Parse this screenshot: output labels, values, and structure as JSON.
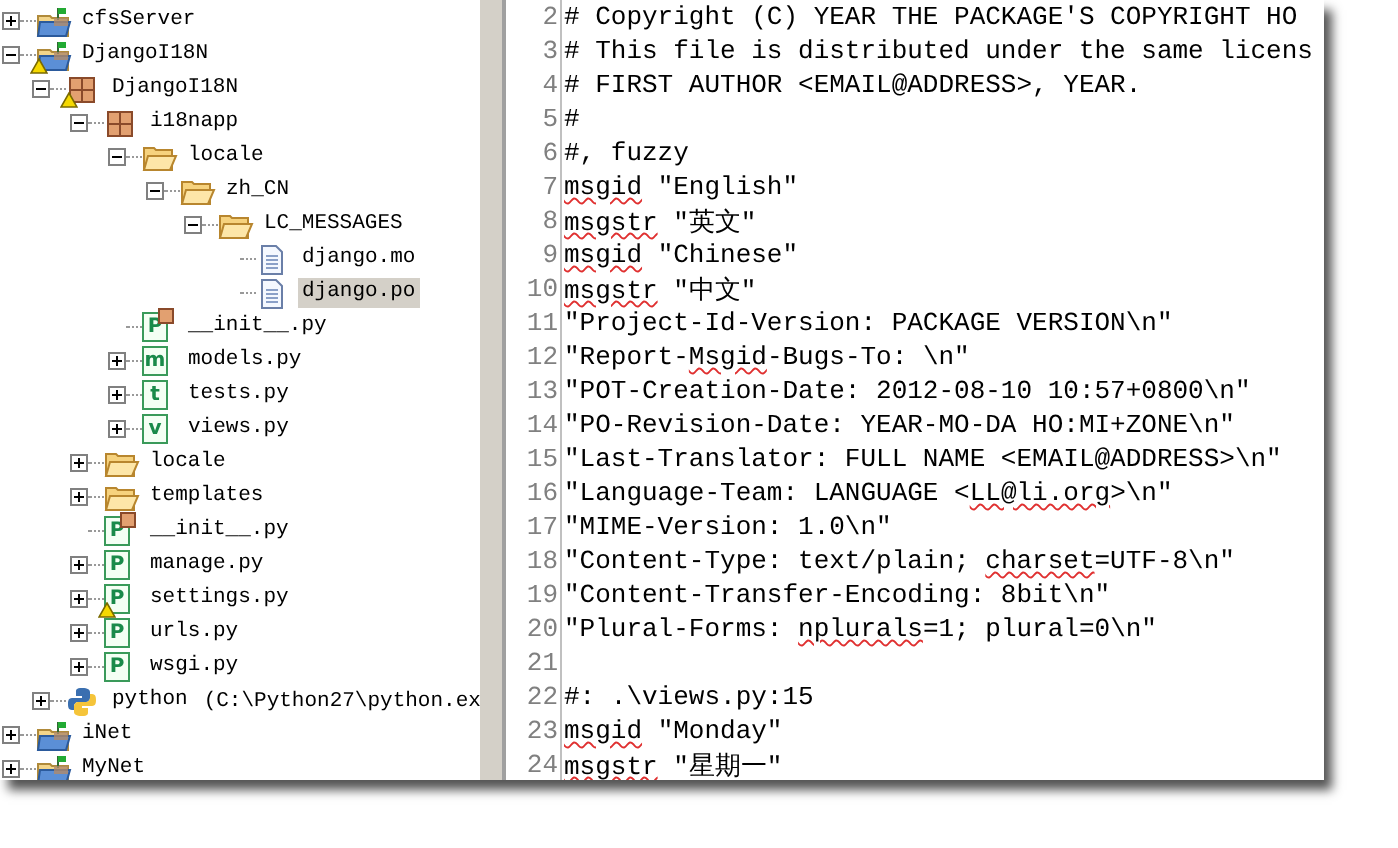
{
  "project_tree": [
    {
      "label": "cfsServer",
      "kind": "project",
      "expanded": false,
      "selected": false
    },
    {
      "label": "DjangoI18N",
      "kind": "project",
      "warning": true,
      "expanded": true,
      "selected": false,
      "children": [
        {
          "label": "DjangoI18N",
          "kind": "package",
          "warning": true,
          "expanded": true,
          "selected": false,
          "children": [
            {
              "label": "i18napp",
              "kind": "package",
              "expanded": true,
              "selected": false,
              "children": [
                {
                  "label": "locale",
                  "kind": "folder",
                  "expanded": true,
                  "selected": false,
                  "children": [
                    {
                      "label": "zh_CN",
                      "kind": "folder",
                      "expanded": true,
                      "selected": false,
                      "children": [
                        {
                          "label": "LC_MESSAGES",
                          "kind": "folder",
                          "expanded": true,
                          "selected": false,
                          "children": [
                            {
                              "label": "django.mo",
                              "kind": "file",
                              "selected": false
                            },
                            {
                              "label": "django.po",
                              "kind": "file",
                              "selected": true
                            }
                          ]
                        }
                      ]
                    }
                  ]
                },
                {
                  "label": "__init__.py",
                  "kind": "init",
                  "letter": "P",
                  "selected": false
                },
                {
                  "label": "models.py",
                  "kind": "module",
                  "letter": "m",
                  "expanded": false,
                  "selected": false
                },
                {
                  "label": "tests.py",
                  "kind": "module",
                  "letter": "t",
                  "expanded": false,
                  "selected": false
                },
                {
                  "label": "views.py",
                  "kind": "module",
                  "letter": "v",
                  "expanded": false,
                  "selected": false
                }
              ]
            },
            {
              "label": "locale",
              "kind": "folder",
              "expanded": false,
              "selected": false
            },
            {
              "label": "templates",
              "kind": "folder",
              "expanded": false,
              "selected": false
            },
            {
              "label": "__init__.py",
              "kind": "init",
              "letter": "P",
              "selected": false
            },
            {
              "label": "manage.py",
              "kind": "module",
              "letter": "P",
              "expanded": false,
              "selected": false
            },
            {
              "label": "settings.py",
              "kind": "module",
              "letter": "P",
              "warning": true,
              "expanded": false,
              "selected": false
            },
            {
              "label": "urls.py",
              "kind": "module",
              "letter": "P",
              "expanded": false,
              "selected": false
            },
            {
              "label": "wsgi.py",
              "kind": "module",
              "letter": "P",
              "expanded": false,
              "selected": false
            }
          ]
        },
        {
          "label": "python",
          "detail": "(C:\\Python27\\python.ex",
          "kind": "interpreter",
          "expanded": false,
          "selected": false
        }
      ]
    },
    {
      "label": "iNet",
      "kind": "project",
      "expanded": false,
      "selected": false
    },
    {
      "label": "MyNet",
      "kind": "project",
      "expanded": false,
      "selected": false
    }
  ],
  "editor_lines": [
    {
      "number": "2",
      "segments": [
        {
          "text": "# Copyright (C) YEAR THE PACKAGE'S COPYRIGHT HO",
          "misspelled": false
        }
      ]
    },
    {
      "number": "3",
      "segments": [
        {
          "text": "# This file is distributed under the same licens",
          "misspelled": false
        }
      ]
    },
    {
      "number": "4",
      "segments": [
        {
          "text": "# FIRST AUTHOR <EMAIL@ADDRESS>, YEAR.",
          "misspelled": false
        }
      ]
    },
    {
      "number": "5",
      "segments": [
        {
          "text": "#",
          "misspelled": false
        }
      ]
    },
    {
      "number": "6",
      "segments": [
        {
          "text": "#, fuzzy",
          "misspelled": false
        }
      ]
    },
    {
      "number": "7",
      "segments": [
        {
          "text": "msgid",
          "misspelled": true
        },
        {
          "text": " \"English\"",
          "misspelled": false
        }
      ]
    },
    {
      "number": "8",
      "segments": [
        {
          "text": "msgstr",
          "misspelled": true
        },
        {
          "text": " \"英文\"",
          "misspelled": false
        }
      ]
    },
    {
      "number": "9",
      "segments": [
        {
          "text": "msgid",
          "misspelled": true
        },
        {
          "text": " \"Chinese\"",
          "misspelled": false
        }
      ]
    },
    {
      "number": "10",
      "segments": [
        {
          "text": "msgstr",
          "misspelled": true
        },
        {
          "text": " \"中文\"",
          "misspelled": false
        }
      ]
    },
    {
      "number": "11",
      "segments": [
        {
          "text": "\"Project-Id-Version: PACKAGE VERSION\\n\"",
          "misspelled": false
        }
      ]
    },
    {
      "number": "12",
      "segments": [
        {
          "text": "\"Report-",
          "misspelled": false
        },
        {
          "text": "Msgid",
          "misspelled": true
        },
        {
          "text": "-Bugs-To: \\n\"",
          "misspelled": false
        }
      ]
    },
    {
      "number": "13",
      "segments": [
        {
          "text": "\"POT-Creation-Date: 2012-08-10 10:57+0800\\n\"",
          "misspelled": false
        }
      ]
    },
    {
      "number": "14",
      "segments": [
        {
          "text": "\"PO-Revision-Date: YEAR-MO-DA HO:MI+ZONE\\n\"",
          "misspelled": false
        }
      ]
    },
    {
      "number": "15",
      "segments": [
        {
          "text": "\"Last-Translator: FULL NAME <EMAIL@ADDRESS>\\n\"",
          "misspelled": false
        }
      ]
    },
    {
      "number": "16",
      "segments": [
        {
          "text": "\"Language-Team: LANGUAGE <",
          "misspelled": false
        },
        {
          "text": "LL@li.org",
          "misspelled": true
        },
        {
          "text": ">\\n\"",
          "misspelled": false
        }
      ]
    },
    {
      "number": "17",
      "segments": [
        {
          "text": "\"MIME-Version: 1.0\\n\"",
          "misspelled": false
        }
      ]
    },
    {
      "number": "18",
      "segments": [
        {
          "text": "\"Content-Type: text/plain; ",
          "misspelled": false
        },
        {
          "text": "charset",
          "misspelled": true
        },
        {
          "text": "=UTF-8\\n\"",
          "misspelled": false
        }
      ]
    },
    {
      "number": "19",
      "segments": [
        {
          "text": "\"Content-Transfer-Encoding: 8bit\\n\"",
          "misspelled": false
        }
      ]
    },
    {
      "number": "20",
      "segments": [
        {
          "text": "\"Plural-Forms: ",
          "misspelled": false
        },
        {
          "text": "nplurals",
          "misspelled": true
        },
        {
          "text": "=1; plural=0\\n\"",
          "misspelled": false
        }
      ]
    },
    {
      "number": "21"
    },
    {
      "number": "22",
      "segments": [
        {
          "text": "#: .\\views.py:15",
          "misspelled": false
        }
      ]
    },
    {
      "number": "23",
      "segments": [
        {
          "text": "msgid",
          "misspelled": true
        },
        {
          "text": " \"Monday\"",
          "misspelled": false
        }
      ]
    },
    {
      "number": "24",
      "segments": [
        {
          "text": "msgstr",
          "misspelled": true
        },
        {
          "text": " \"星期一\"",
          "misspelled": false
        }
      ]
    }
  ]
}
